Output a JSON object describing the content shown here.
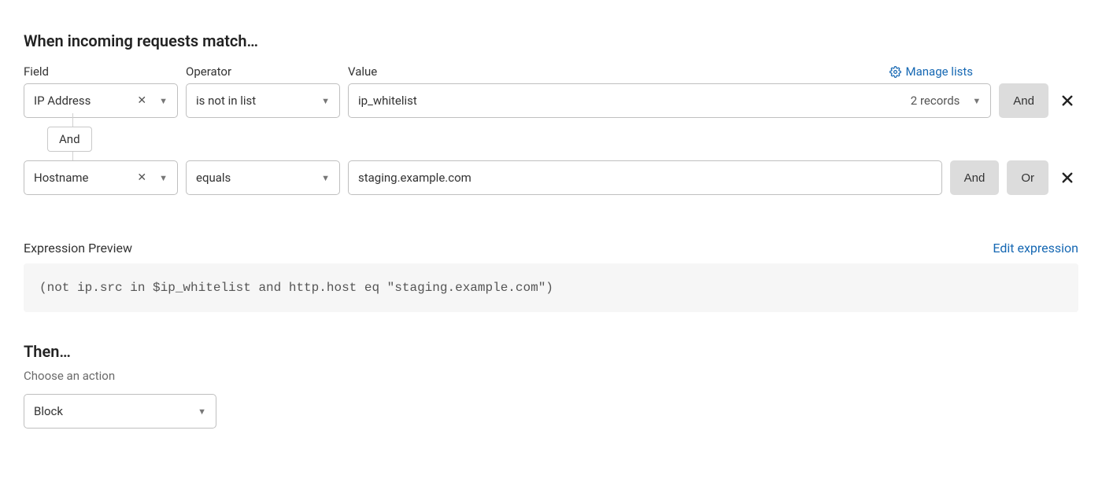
{
  "header": {
    "title": "When incoming requests match…",
    "col_field": "Field",
    "col_operator": "Operator",
    "col_value": "Value",
    "manage_lists": "Manage lists"
  },
  "rules": [
    {
      "field": "IP Address",
      "operator": "is not in list",
      "value": "ip_whitelist",
      "value_right": "2 records",
      "value_type": "list_select",
      "buttons": {
        "and": "And"
      }
    },
    {
      "field": "Hostname",
      "operator": "equals",
      "value": "staging.example.com",
      "value_type": "text",
      "buttons": {
        "and": "And",
        "or": "Or"
      }
    }
  ],
  "connector": {
    "label": "And"
  },
  "preview": {
    "label": "Expression Preview",
    "edit": "Edit expression",
    "expression": "(not ip.src in $ip_whitelist and http.host eq \"staging.example.com\")"
  },
  "then": {
    "title": "Then…",
    "subtitle": "Choose an action",
    "action": "Block"
  }
}
